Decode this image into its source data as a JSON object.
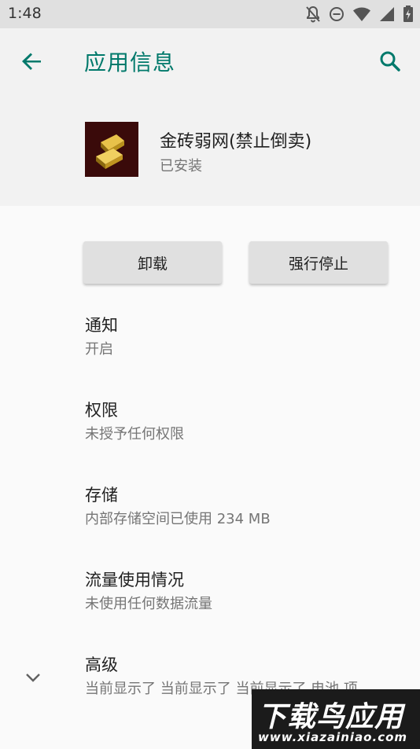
{
  "status_bar": {
    "time": "1:48"
  },
  "app_bar": {
    "title": "应用信息"
  },
  "app": {
    "name": "金砖弱网(禁止倒卖)",
    "status": "已安装"
  },
  "buttons": {
    "uninstall": "卸载",
    "force_stop": "强行停止"
  },
  "settings": [
    {
      "title": "通知",
      "subtitle": "开启"
    },
    {
      "title": "权限",
      "subtitle": "未授予任何权限"
    },
    {
      "title": "存储",
      "subtitle": "内部存储空间已使用 234 MB"
    },
    {
      "title": "流量使用情况",
      "subtitle": "未使用任何数据流量"
    },
    {
      "title": "高级",
      "subtitle": "当前显示了 当前显示了 当前显示了 电池 项.."
    }
  ],
  "watermark": {
    "title": "下载鸟应用",
    "url": "www.xiazainiao.com"
  },
  "colors": {
    "accent": "#00796b",
    "header_bg": "#f2f2f2",
    "status_bg": "#e0e0e0"
  }
}
